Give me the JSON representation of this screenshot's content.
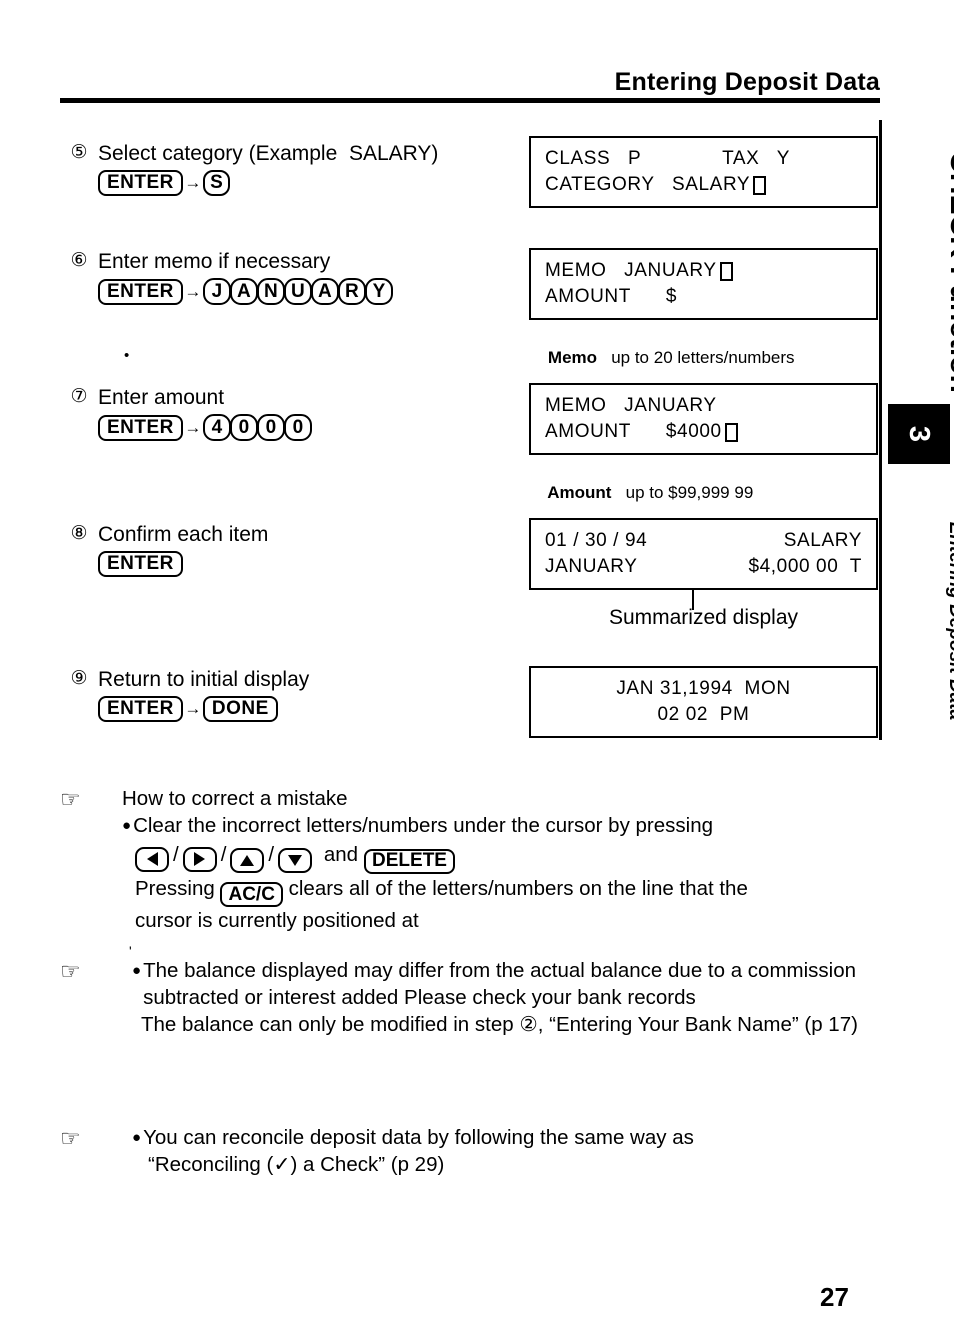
{
  "header": {
    "title": "Entering Deposit Data"
  },
  "side_tab": {
    "title": "CHECK Function",
    "chapter_number": "3",
    "subtitle": "Entering Deposit Data"
  },
  "steps": [
    {
      "number": "⑤",
      "text": "Select category (Example  SALARY)",
      "keys": [
        "ENTER",
        "S"
      ]
    },
    {
      "number": "⑥",
      "text": "Enter memo if necessary",
      "keys": [
        "ENTER",
        "J",
        "A",
        "N",
        "U",
        "A",
        "R",
        "Y"
      ]
    },
    {
      "number": "⑦",
      "text": "Enter amount",
      "keys": [
        "ENTER",
        "4",
        "0",
        "0",
        "0"
      ]
    },
    {
      "number": "⑧",
      "text": "Confirm each item",
      "keys": [
        "ENTER"
      ]
    },
    {
      "number": "⑨",
      "text": "Return to initial display",
      "keys": [
        "ENTER",
        "DONE"
      ]
    }
  ],
  "displays": [
    {
      "name": "class-tax-category-display",
      "line1_left": "CLASS   P",
      "line1_right": "TAX   Y",
      "line2": "CATEGORY   SALARY",
      "line2_cursor": true
    },
    {
      "name": "memo-amount-empty-display",
      "line1": "MEMO   JANUARY",
      "line1_cursor": true,
      "line2": "AMOUNT      $"
    },
    {
      "name": "memo-amount-filled-display",
      "line1": "MEMO   JANUARY",
      "line2": "AMOUNT      $4000",
      "line2_cursor": true
    },
    {
      "name": "summarized-display",
      "line1_left": "01 / 30 / 94",
      "line1_right": "SALARY",
      "line2_left": "JANUARY",
      "line2_right": "$4,000 00  T"
    },
    {
      "name": "initial-display",
      "line1": "JAN 31,1994  MON",
      "line2": "02 02  PM"
    }
  ],
  "captions": {
    "memo_limit_label": "Memo",
    "memo_limit_text": "   up to 20 letters/numbers",
    "amount_limit_label": "Amount",
    "amount_limit_text": "   up to $99,999 99",
    "summarized_display": "Summarized display"
  },
  "notes": [
    {
      "icon": "pointing-hand-icon",
      "heading": "How to correct a mistake",
      "line_a_pre": "Clear the incorrect letters/numbers under the cursor by pressing",
      "keys": [
        "left-arrow",
        "right-arrow",
        "up-arrow",
        "down-arrow"
      ],
      "and_label": "and",
      "delete_key": "DELETE",
      "line_b_pre": "Pressing",
      "acc_key": "AC/C",
      "line_b_post": "clears all of the letters/numbers on the line that the",
      "line_c": "cursor is currently positioned at"
    },
    {
      "icon": "pointing-hand-icon",
      "bullet": true,
      "paragraph1": "The balance displayed may differ from the actual balance due to a commission subtracted or interest added  Please check your bank records",
      "paragraph2": "The balance can only be modified in step ②, “Entering Your Bank Name” (p  17)"
    },
    {
      "icon": "pointing-hand-icon",
      "bullet": true,
      "paragraph1": "You can reconcile deposit data by following the same way as",
      "paragraph2": "“Reconciling (✓) a Check” (p  29)"
    }
  ],
  "page_number": "27",
  "icons": {
    "pointing_hand": "☞",
    "cursor_block": "cursor-block-icon"
  }
}
